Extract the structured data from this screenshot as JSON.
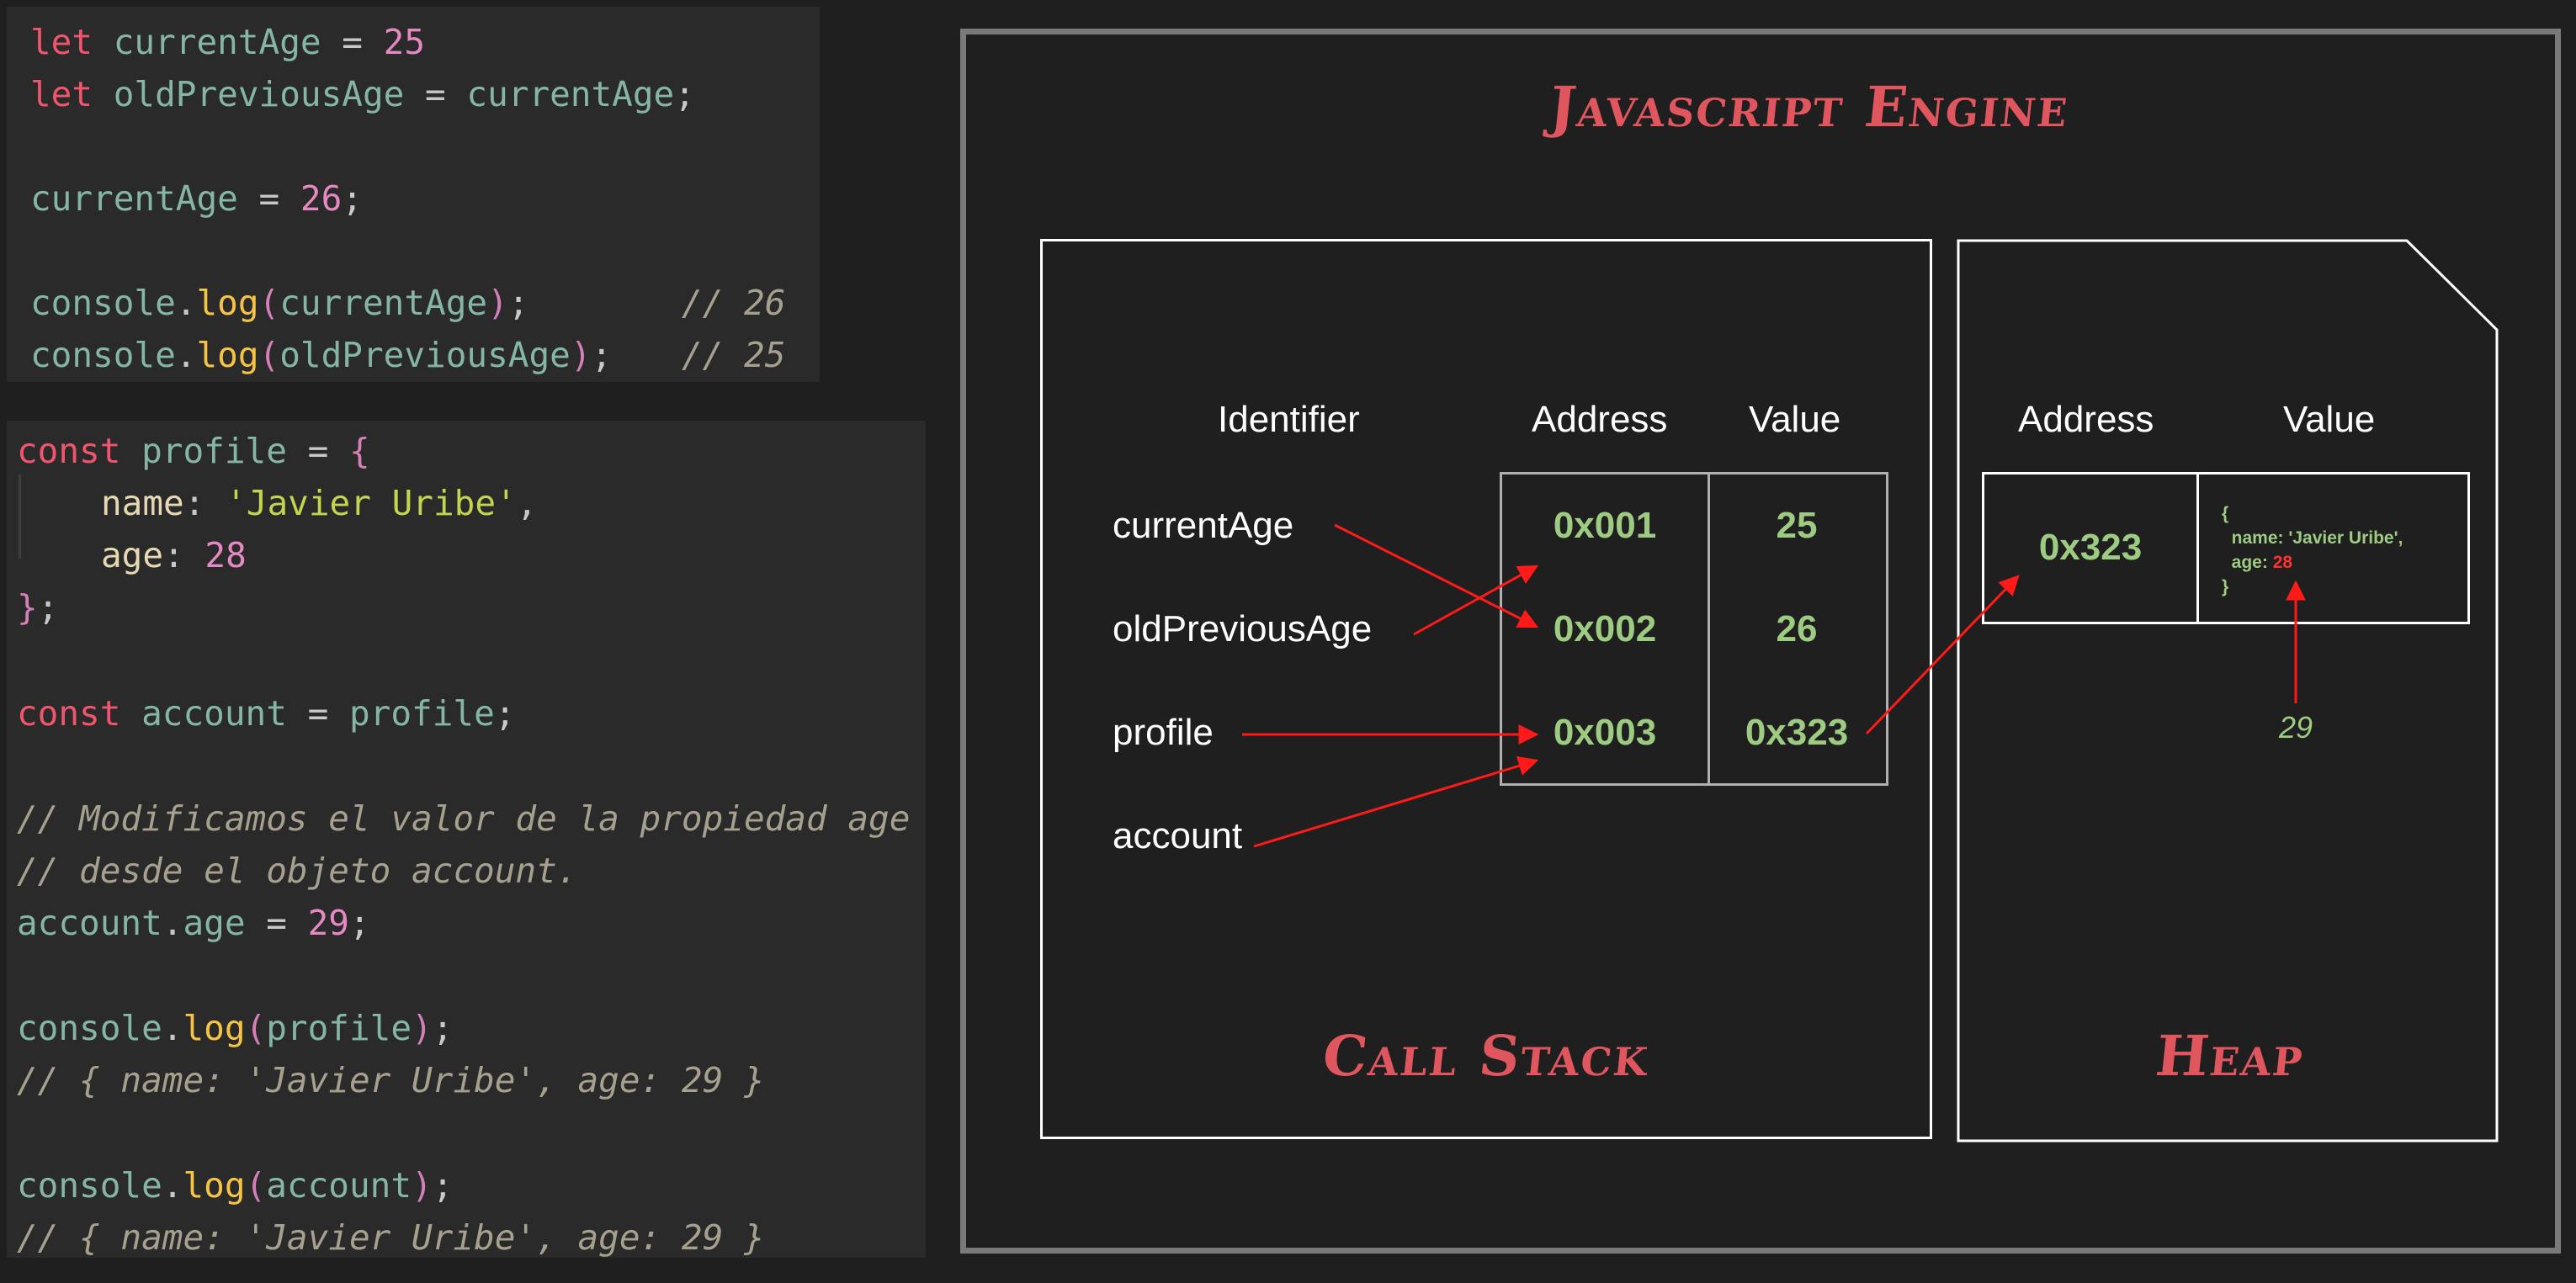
{
  "code_top": {
    "line1": {
      "kw": "let",
      "name": " currentAge ",
      "op": "=",
      "num": " 25"
    },
    "line2": {
      "kw": "let",
      "name": " oldPreviousAge ",
      "op": "=",
      "val": " currentAge",
      "end": ";"
    },
    "line3": {
      "name": "currentAge ",
      "op": "=",
      "num": " 26",
      "end": ";"
    },
    "line4": {
      "obj": "console",
      "dot": ".",
      "fn": "log",
      "open": "(",
      "arg": "currentAge",
      "close": ")",
      "end": ";",
      "comment": "// 26"
    },
    "line5": {
      "obj": "console",
      "dot": ".",
      "fn": "log",
      "open": "(",
      "arg": "oldPreviousAge",
      "close": ")",
      "end": ";",
      "comment": "// 25"
    }
  },
  "code_bottom": {
    "line1": {
      "kw": "const",
      "name": " profile ",
      "op": "=",
      "brace": " {"
    },
    "line2": {
      "prop": "name",
      "colon": ":",
      "str": " 'Javier Uribe'",
      "comma": ","
    },
    "line3": {
      "prop": "age",
      "colon": ":",
      "num": " 28"
    },
    "line4": {
      "brace": "}",
      "end": ";"
    },
    "line5": {
      "kw": "const",
      "name": " account ",
      "op": "=",
      "val": " profile",
      "end": ";"
    },
    "line6": {
      "comment": "// Modificamos el valor de la propiedad age"
    },
    "line7": {
      "comment": "// desde el objeto account."
    },
    "line8": {
      "obj": "account",
      "dot": ".",
      "prop": "age ",
      "op": "=",
      "num": " 29",
      "end": ";"
    },
    "line9": {
      "obj": "console",
      "dot": ".",
      "fn": "log",
      "open": "(",
      "arg": "profile",
      "close": ")",
      "end": ";"
    },
    "line10": {
      "comment": "// { name: 'Javier Uribe', age: 29 }"
    },
    "line11": {
      "obj": "console",
      "dot": ".",
      "fn": "log",
      "open": "(",
      "arg": "account",
      "close": ")",
      "end": ";"
    },
    "line12": {
      "comment": "// { name: 'Javier Uribe', age: 29 }"
    }
  },
  "diagram": {
    "engine_title": "Javascript Engine",
    "stack_title": "Call Stack",
    "heap_title": "Heap",
    "stack_headers": {
      "identifier": "Identifier",
      "address": "Address",
      "value": "Value"
    },
    "stack_rows": [
      {
        "identifier": "currentAge",
        "address": "0x001",
        "value": "25"
      },
      {
        "identifier": "oldPreviousAge",
        "address": "0x002",
        "value": "26"
      },
      {
        "identifier": "profile",
        "address": "0x003",
        "value": "0x323"
      },
      {
        "identifier": "account"
      }
    ],
    "heap_headers": {
      "address": "Address",
      "value": "Value"
    },
    "heap_row": {
      "address": "0x323",
      "value_line1": "{",
      "value_line2": "  name: 'Javier Uribe',",
      "value_line3_label": "  age: ",
      "value_line3_num": "28",
      "value_line4": "}"
    },
    "new_age_value": "29",
    "colors": {
      "arrow": "#ff1a1a",
      "accent_title": "#e0565f",
      "value_green": "#9ccb81"
    }
  }
}
